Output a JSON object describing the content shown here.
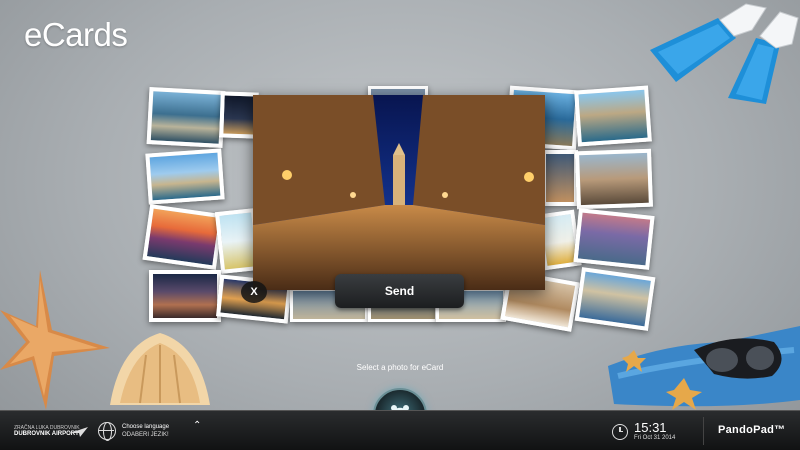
{
  "app": {
    "title": "eCards"
  },
  "gallery": {
    "close_label": "X",
    "send_label": "Send",
    "hint": "Select a photo for eCard"
  },
  "bottom_bar": {
    "airport_line1": "ZRAČNA LUKA DUBROVNIK",
    "airport_line2": "DUBROVNIK AIRPORT",
    "language_title": "Choose language",
    "language_sub": "ODABERI JEZIK!",
    "language_chevron": "⌃",
    "time": "15:31",
    "date": "Fri Oct 31 2014",
    "brand": "PandoPad™"
  },
  "colors": {
    "background": "#b0b5b9",
    "bar": "#1a1b1c",
    "home_glow": "#5aaabe"
  }
}
